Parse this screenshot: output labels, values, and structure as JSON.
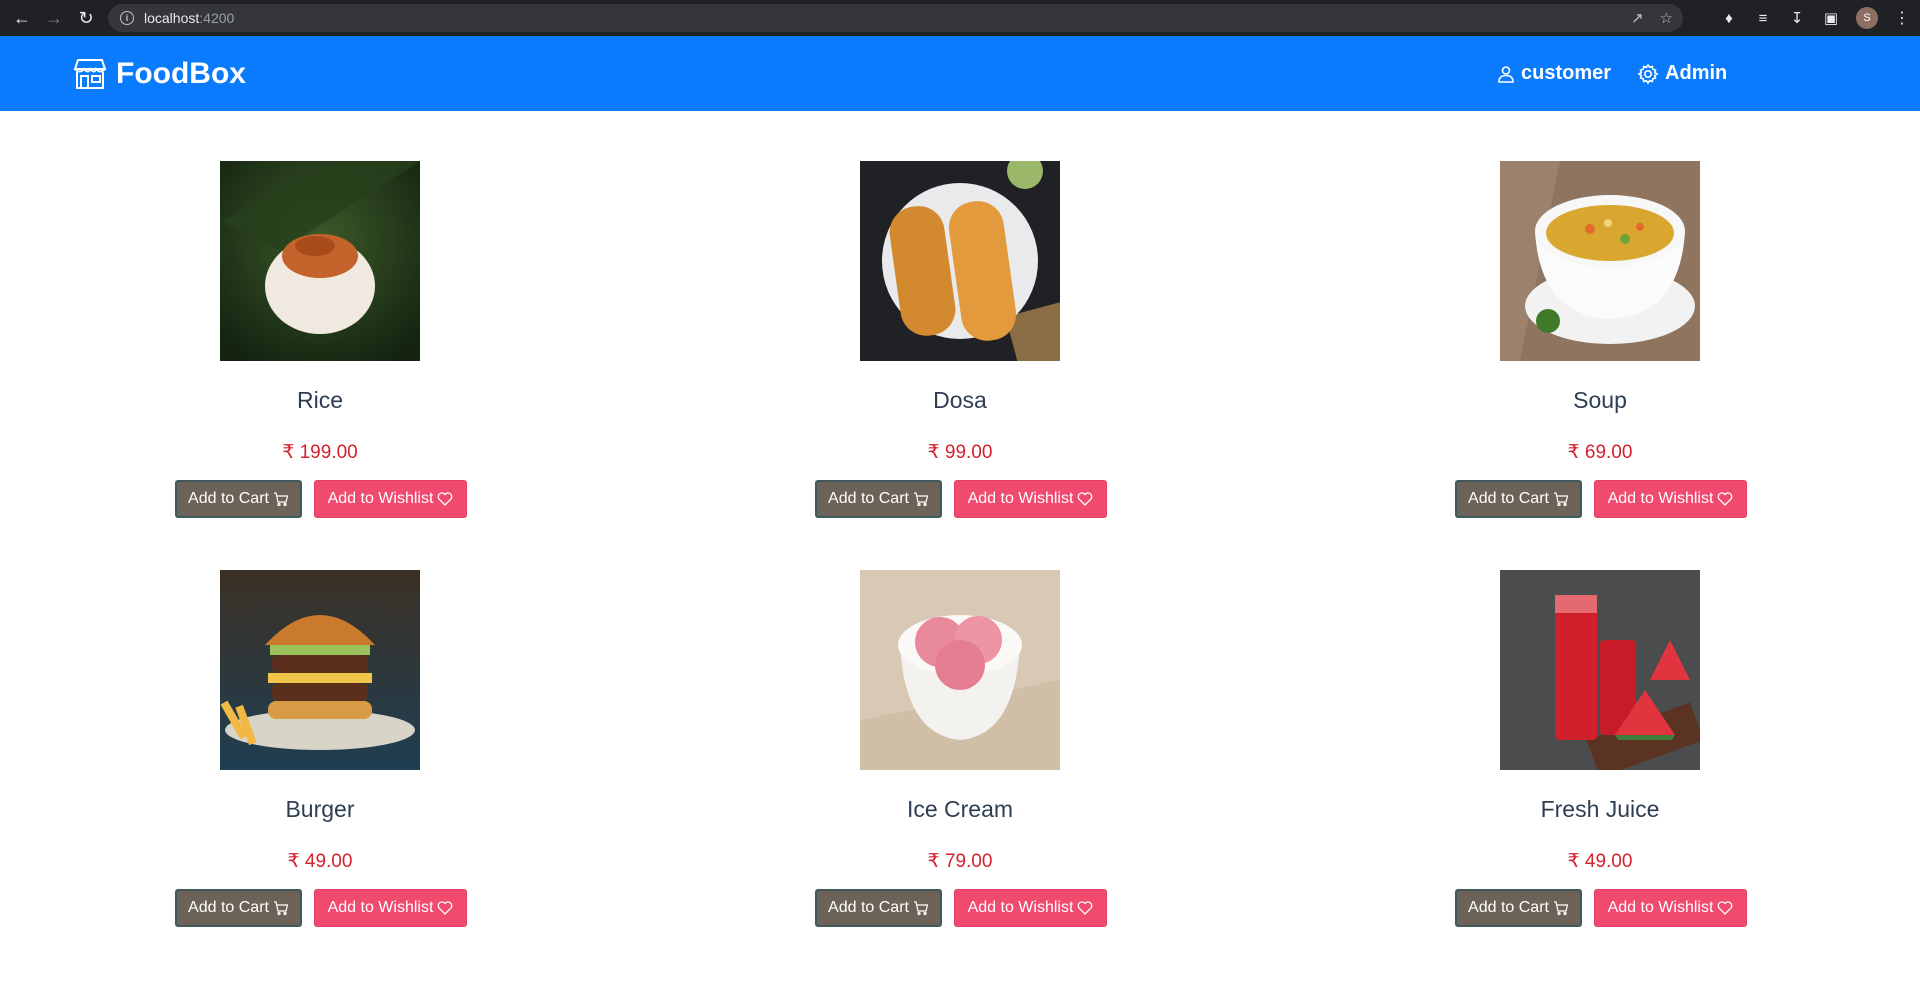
{
  "browser": {
    "url_host": "localhost",
    "url_port": ":4200",
    "profile_initial": "S"
  },
  "navbar": {
    "brand": "FoodBox",
    "links": [
      {
        "label": "customer",
        "icon": "user-icon"
      },
      {
        "label": "Admin",
        "icon": "gear-icon"
      }
    ]
  },
  "colors": {
    "navbar_bg": "#0b7bfd",
    "price": "#d3222c",
    "cart_button": "#6d6257",
    "wishlist_button": "#f04a6f"
  },
  "products": [
    {
      "name": "Rice",
      "price": "₹ 199.00",
      "image": "rice"
    },
    {
      "name": "Dosa",
      "price": "₹ 99.00",
      "image": "dosa"
    },
    {
      "name": "Soup",
      "price": "₹ 69.00",
      "image": "soup"
    },
    {
      "name": "Burger",
      "price": "₹ 49.00",
      "image": "burger"
    },
    {
      "name": "Ice Cream",
      "price": "₹ 79.00",
      "image": "ice-cream"
    },
    {
      "name": "Fresh Juice",
      "price": "₹ 49.00",
      "image": "fresh-juice"
    }
  ],
  "buttons": {
    "add_to_cart": "Add to Cart",
    "add_to_wishlist": "Add to Wishlist"
  }
}
